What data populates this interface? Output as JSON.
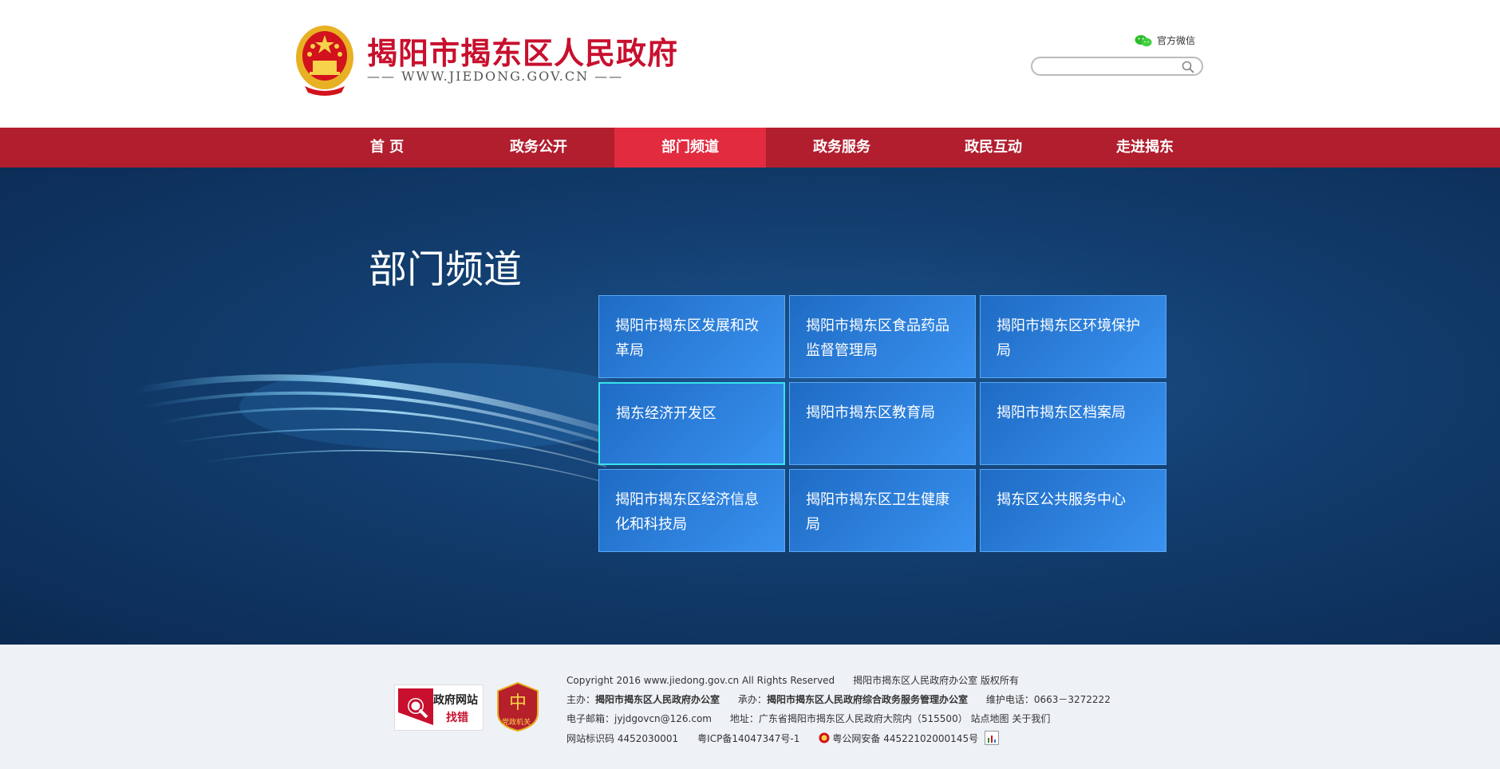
{
  "header": {
    "site_title": "揭阳市揭东区人民政府",
    "site_url": "—— WWW.JIEDONG.GOV.CN ——",
    "wechat_label": "官方微信",
    "search_placeholder": ""
  },
  "nav": {
    "items": [
      "首 页",
      "政务公开",
      "部门频道",
      "政务服务",
      "政民互动",
      "走进揭东"
    ],
    "active_index": 2
  },
  "hero": {
    "title": "部门频道",
    "cards": [
      "揭阳市揭东区发展和改革局",
      "揭阳市揭东区食品药品监督管理局",
      "揭阳市揭东区环境保护局",
      "揭东经济开发区",
      "揭阳市揭东区教育局",
      "揭阳市揭东区档案局",
      "揭阳市揭东区经济信息化和科技局",
      "揭阳市揭东区卫生健康局",
      "揭东区公共服务中心"
    ]
  },
  "footer": {
    "badge_find_top": "政府网站",
    "badge_find_bottom": "找错",
    "badge_party": "党政机关",
    "copyright": "Copyright 2016 www.jiedong.gov.cn All Rights Reserved",
    "rights_holder": "揭阳市揭东区人民政府办公室 版权所有",
    "host_label": "主办：",
    "host_value": "揭阳市揭东区人民政府办公室",
    "organizer_label": "承办：",
    "organizer_value": "揭阳市揭东区人民政府综合政务服务管理办公室",
    "phone": "维护电话：0663－3272222",
    "email": "电子邮箱：jyjdgovcn@126.com",
    "address": "地址：广东省揭阳市揭东区人民政府大院内（515500）",
    "sitemap": "站点地图",
    "about": "关于我们",
    "site_id": "网站标识码 4452030001",
    "icp": "粤ICP备14047347号-1",
    "police": "粤公网安备 44522102000145号"
  },
  "colors": {
    "nav_bg": "#b11e2e",
    "nav_active": "#e22b3f",
    "title_red": "#c8102e",
    "card_blue": "#2b7fdc"
  }
}
